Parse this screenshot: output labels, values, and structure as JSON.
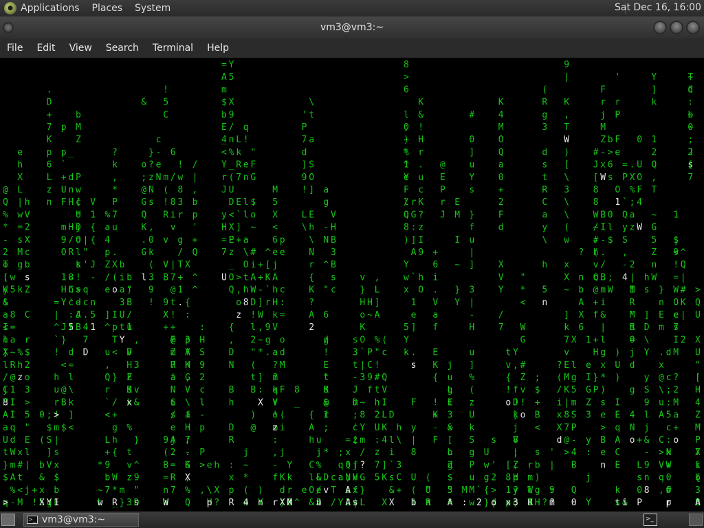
{
  "top_panel": {
    "menus": [
      "Applications",
      "Places",
      "System"
    ],
    "clock": "Sat Dec 16, 16:00",
    "logo_icon": "gnome-foot-icon"
  },
  "window": {
    "title": "vm3@vm3:~",
    "menu": [
      "File",
      "Edit",
      "View",
      "Search",
      "Terminal",
      "Help"
    ]
  },
  "taskbar": {
    "task_label": "vm3@vm3:~",
    "task_icon": "terminal-icon",
    "tray_icon": "terminal-icon"
  },
  "colors": {
    "matrix_green": "#16c416",
    "matrix_white": "#e8e8e8",
    "background": "#000000"
  },
  "terminal": {
    "content": "matrix-rain",
    "white_chars": "6YoIUdXsnzWWRXUMoBCnQ0XCiPvrzpK6mt8D82W5FyLuA2DWbo8X1XXtpSA8J\n#'X'0bqzpw1Mnw2'MrXIUtXTWGd8QCY.hDR3xX?g>x6vsfVtSPgAZ:lQx4RJU"
  }
}
